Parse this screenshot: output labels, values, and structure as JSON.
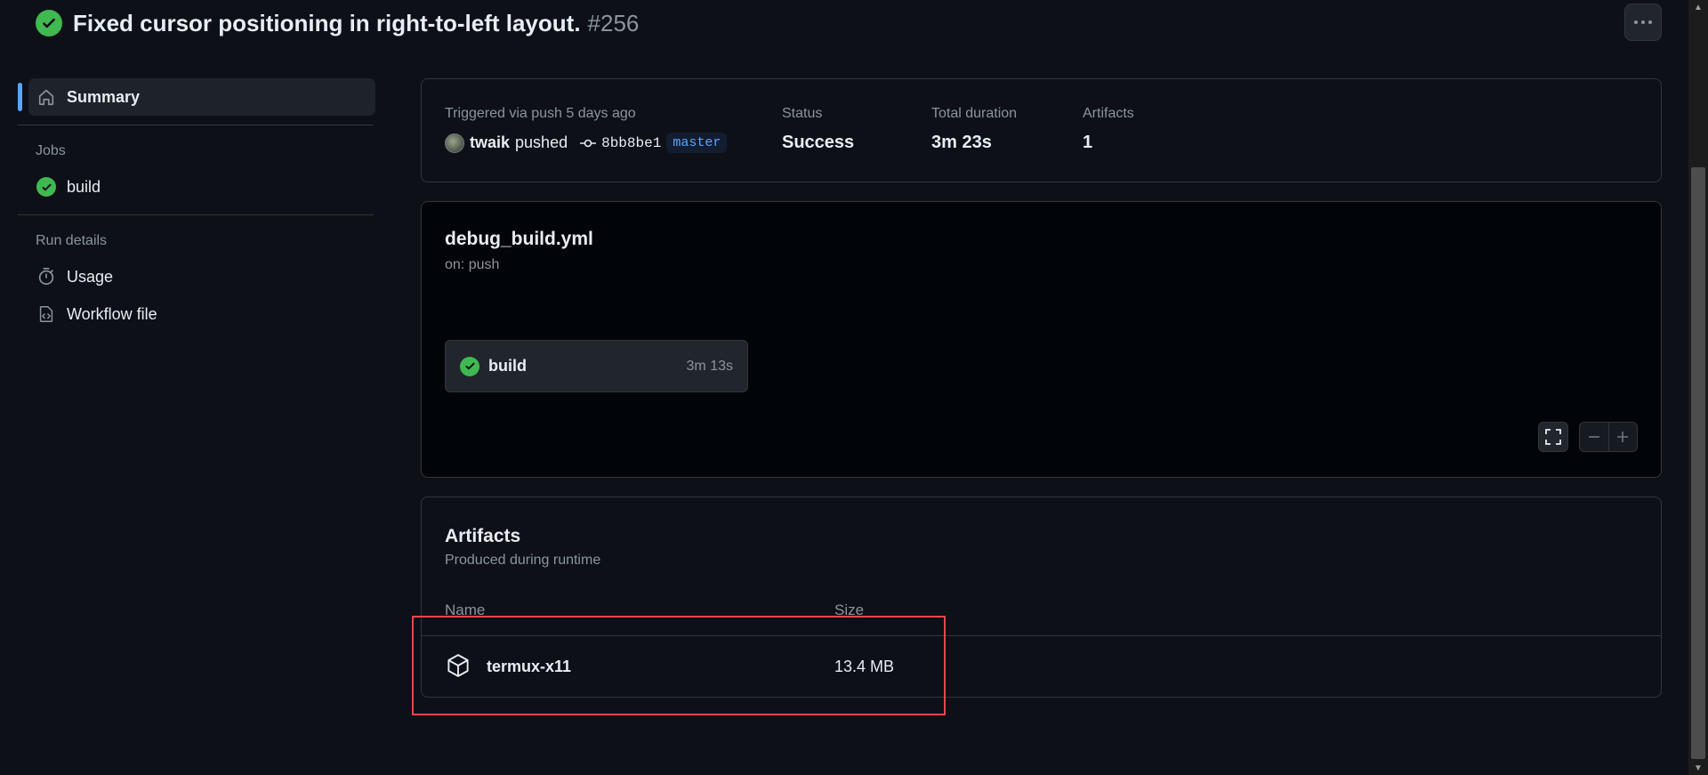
{
  "header": {
    "title": "Fixed cursor positioning in right-to-left layout.",
    "run_number": "#256"
  },
  "sidebar": {
    "summary_label": "Summary",
    "jobs_heading": "Jobs",
    "jobs": [
      {
        "label": "build",
        "status": "success"
      }
    ],
    "run_details_heading": "Run details",
    "run_details": [
      {
        "label": "Usage",
        "icon": "stopwatch-icon"
      },
      {
        "label": "Workflow file",
        "icon": "file-code-icon"
      }
    ]
  },
  "summary": {
    "trigger_label": "Triggered via push 5 days ago",
    "user": "twaik",
    "action": "pushed",
    "commit_sha": "8bb8be1",
    "branch": "master",
    "status_label": "Status",
    "status_value": "Success",
    "duration_label": "Total duration",
    "duration_value": "3m 23s",
    "artifacts_label": "Artifacts",
    "artifacts_value": "1"
  },
  "workflow": {
    "file_name": "debug_build.yml",
    "trigger": "on: push",
    "job": {
      "name": "build",
      "duration": "3m 13s"
    }
  },
  "artifacts": {
    "title": "Artifacts",
    "subtitle": "Produced during runtime",
    "columns": [
      "Name",
      "Size"
    ],
    "items": [
      {
        "name": "termux-x11",
        "size": "13.4 MB"
      }
    ]
  },
  "colors": {
    "background": "#0d1117",
    "success": "#3fb950",
    "accent": "#58a6ff",
    "highlight": "#e5484d"
  }
}
